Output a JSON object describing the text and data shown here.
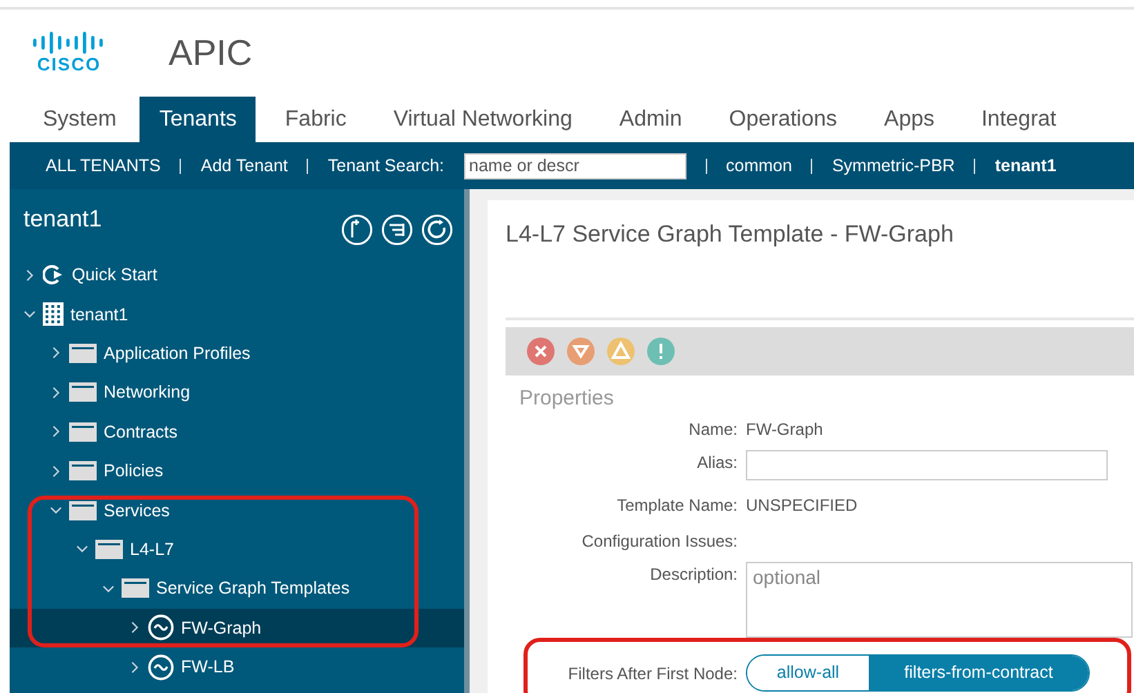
{
  "app": {
    "logo": "CISCO",
    "title": "APIC"
  },
  "tabs": [
    {
      "label": "System",
      "selected": false
    },
    {
      "label": "Tenants",
      "selected": true
    },
    {
      "label": "Fabric",
      "selected": false
    },
    {
      "label": "Virtual Networking",
      "selected": false
    },
    {
      "label": "Admin",
      "selected": false
    },
    {
      "label": "Operations",
      "selected": false
    },
    {
      "label": "Apps",
      "selected": false
    },
    {
      "label": "Integrat",
      "selected": false
    }
  ],
  "subnav": {
    "items": [
      {
        "label": "ALL TENANTS",
        "selected": false
      },
      {
        "label": "Add Tenant",
        "selected": false
      }
    ],
    "search_label": "Tenant Search:",
    "search_placeholder": "name or descr",
    "tenants": [
      {
        "label": "common",
        "selected": false
      },
      {
        "label": "Symmetric-PBR",
        "selected": false
      },
      {
        "label": "tenant1",
        "selected": true
      }
    ]
  },
  "sidebar": {
    "title": "tenant1",
    "tree": [
      {
        "label": "Quick Start",
        "kind": "quickstart",
        "expanded": false,
        "selected": false
      },
      {
        "label": "tenant1",
        "kind": "building",
        "expanded": true,
        "selected": false,
        "children": [
          {
            "label": "Application Profiles",
            "kind": "folder",
            "expanded": false,
            "selected": false
          },
          {
            "label": "Networking",
            "kind": "folder",
            "expanded": false,
            "selected": false
          },
          {
            "label": "Contracts",
            "kind": "folder",
            "expanded": false,
            "selected": false
          },
          {
            "label": "Policies",
            "kind": "folder",
            "expanded": false,
            "selected": false
          },
          {
            "label": "Services",
            "kind": "folder",
            "expanded": true,
            "selected": false,
            "children": [
              {
                "label": "L4-L7",
                "kind": "folder",
                "expanded": true,
                "selected": false,
                "children": [
                  {
                    "label": "Service Graph Templates",
                    "kind": "folder",
                    "expanded": true,
                    "selected": false,
                    "children": [
                      {
                        "label": "FW-Graph",
                        "kind": "graph",
                        "expanded": false,
                        "selected": true
                      },
                      {
                        "label": "FW-LB",
                        "kind": "graph",
                        "expanded": false,
                        "selected": false
                      }
                    ]
                  }
                ]
              }
            ]
          }
        ]
      }
    ]
  },
  "panel": {
    "title": "L4-L7 Service Graph Template - FW-Graph",
    "section": "Properties",
    "fields": [
      {
        "label": "Name:",
        "kind": "text",
        "value": "FW-Graph"
      },
      {
        "label": "Alias:",
        "kind": "input"
      },
      {
        "label": "Template Name:",
        "kind": "text",
        "value": "UNSPECIFIED"
      },
      {
        "label": "Configuration Issues:",
        "kind": "text"
      },
      {
        "label": "Description:",
        "kind": "textarea",
        "placeholder": "optional"
      },
      {
        "label": "Filters After First Node:",
        "kind": "toggle",
        "options": [
          {
            "label": "allow-all",
            "selected": false
          },
          {
            "label": "filters-from-contract",
            "selected": true
          }
        ]
      }
    ]
  }
}
